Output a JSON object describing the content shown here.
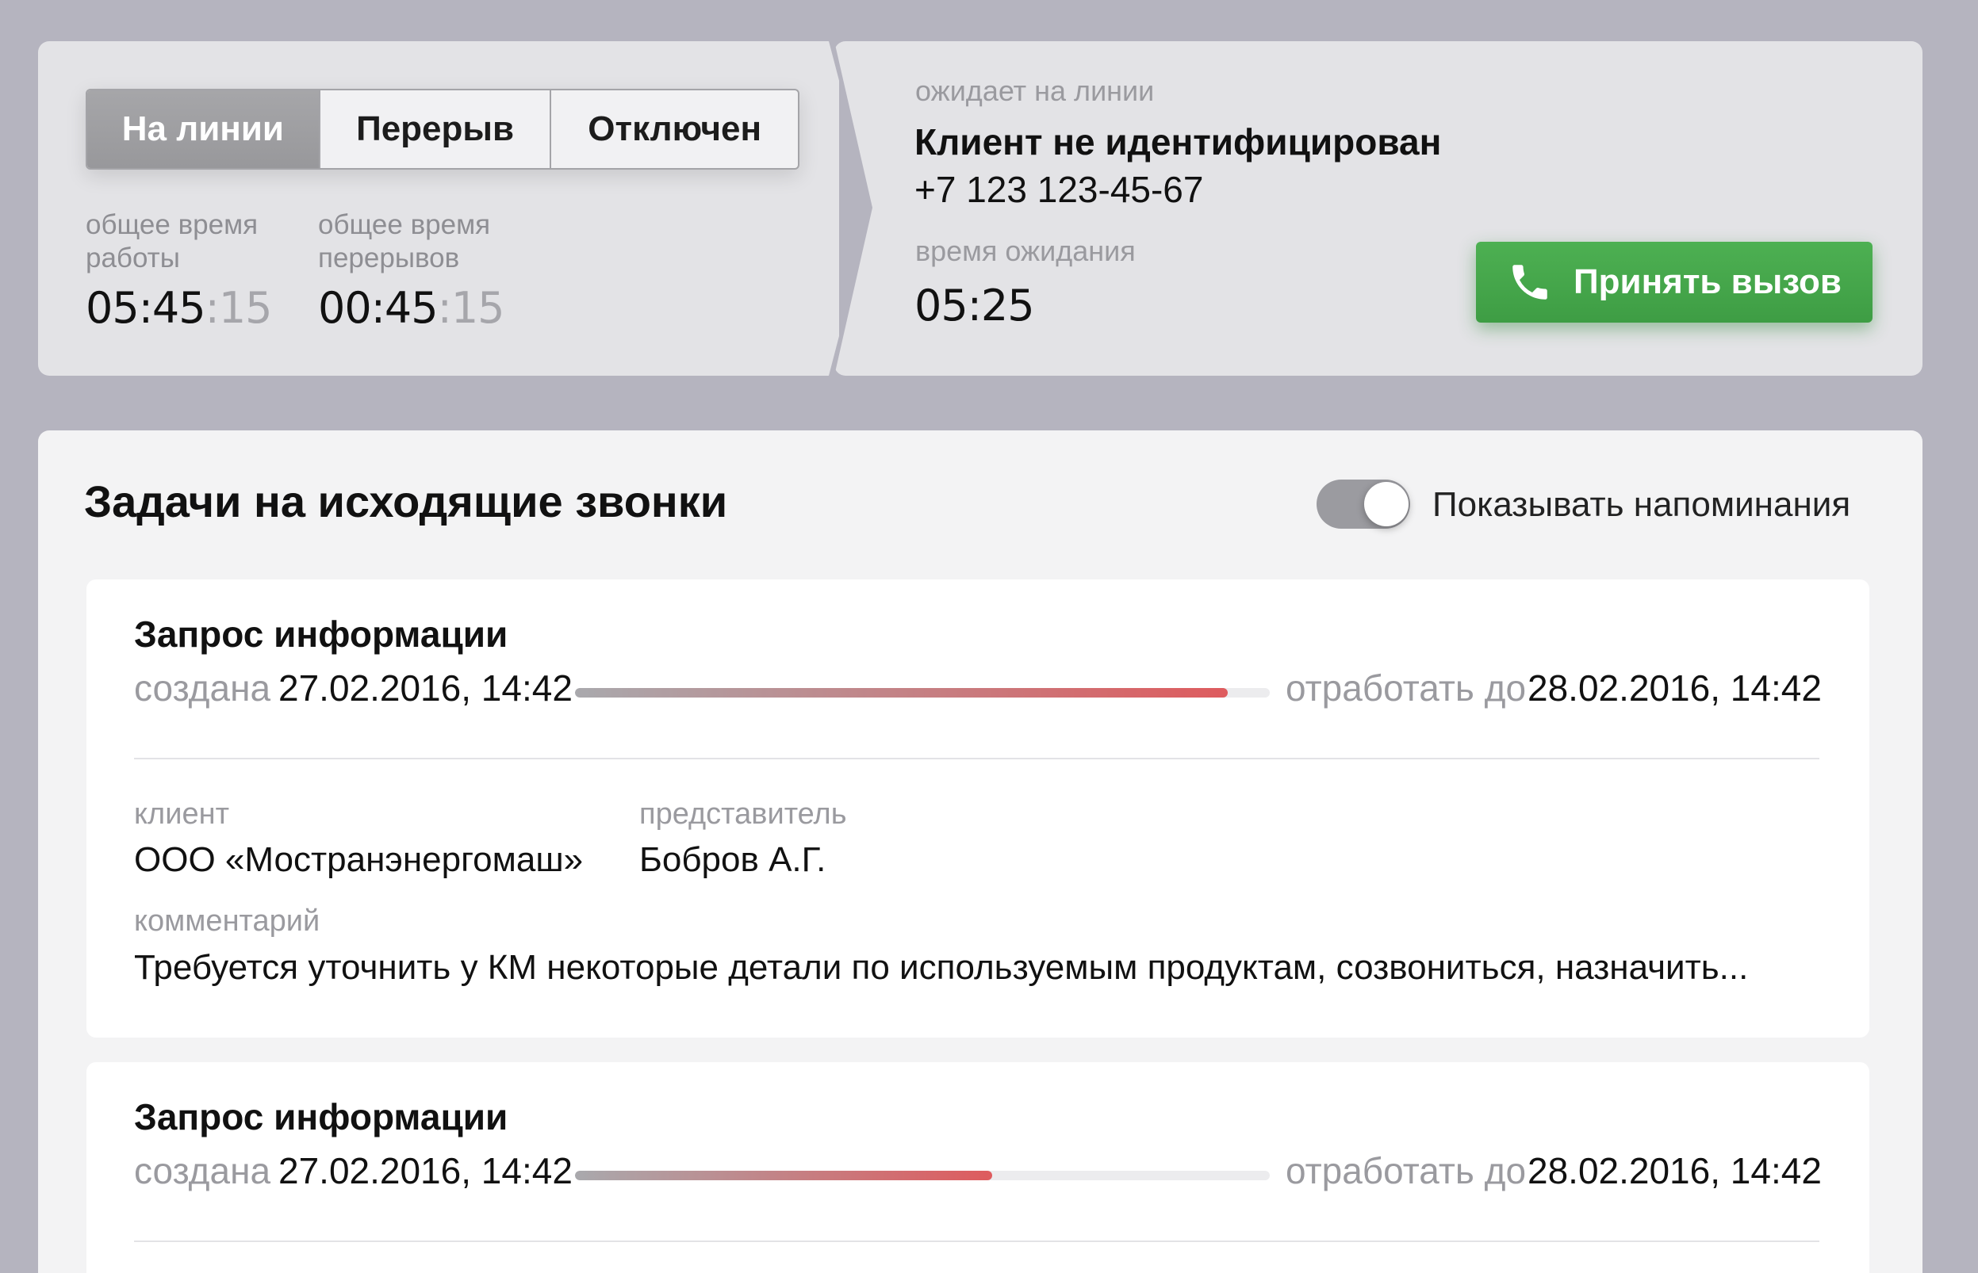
{
  "status": {
    "modes": [
      {
        "label": "На линии",
        "active": true
      },
      {
        "label": "Перерыв",
        "active": false
      },
      {
        "label": "Отключен",
        "active": false
      }
    ],
    "work_time": {
      "label": "общее время работы",
      "main": "05:45",
      "sec": ":15"
    },
    "break_time": {
      "label": "общее время перерывов",
      "main": "00:45",
      "sec": ":15"
    }
  },
  "incoming": {
    "label": "ожидает на линии",
    "client_name": "Клиент не идентифицирован",
    "phone": "+7 123 123-45-67",
    "wait_label": "время ожидания",
    "wait_value": "05:25",
    "accept_label": "Принять вызов",
    "accept_icon": "phone-icon",
    "accept_color": "#46a84b"
  },
  "tasks": {
    "title": "Задачи на исходящие звонки",
    "reminder_toggle": {
      "label": "Показывать напоминания",
      "on": true
    },
    "items": [
      {
        "title": "Запрос информации",
        "created_label": "создана",
        "created": "27.02.2016, 14:42",
        "due_label": "отработать до",
        "due": "28.02.2016, 14:42",
        "progress": 0.94,
        "client_label": "клиент",
        "client": "ООО «Мостранэнергомаш»",
        "rep_label": "представитель",
        "rep": "Бобров А.Г.",
        "comment_label": "комментарий",
        "comment": "Требуется уточнить у КМ некоторые детали по используемым продуктам, созвониться, назначить..."
      },
      {
        "title": "Запрос информации",
        "created_label": "создана",
        "created": "27.02.2016, 14:42",
        "due_label": "отработать до",
        "due": "28.02.2016, 14:42",
        "progress": 0.6
      }
    ]
  }
}
